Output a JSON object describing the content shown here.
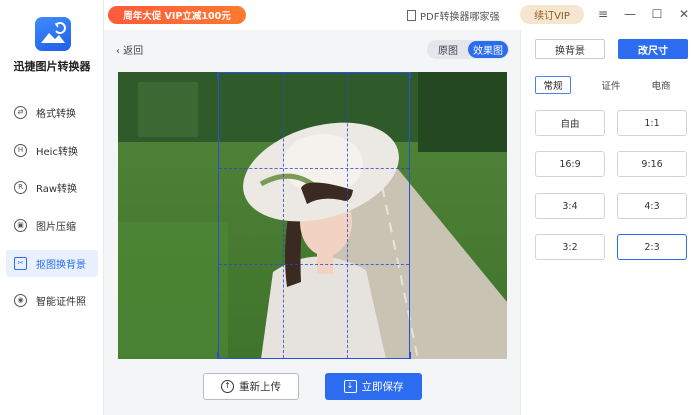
{
  "app": {
    "title": "迅捷图片转换器"
  },
  "sidebar": {
    "items": [
      {
        "label": "格式转换",
        "icon": "format-convert-icon",
        "glyph": "⇄"
      },
      {
        "label": "Heic转换",
        "icon": "heic-icon",
        "glyph": "H"
      },
      {
        "label": "Raw转换",
        "icon": "raw-icon",
        "glyph": "R"
      },
      {
        "label": "图片压缩",
        "icon": "compress-icon",
        "glyph": "▣"
      },
      {
        "label": "抠图换背景",
        "icon": "cutout-icon",
        "glyph": "✂"
      },
      {
        "label": "智能证件照",
        "icon": "id-photo-icon",
        "glyph": "◉"
      }
    ],
    "active_index": 4
  },
  "topbar": {
    "promo": "周年大促 VIP立减100元",
    "pdf_link": "PDF转换器哪家强",
    "vip_button": "续订VIP",
    "menu_glyph": "≡",
    "minimize_glyph": "—",
    "maximize_glyph": "☐",
    "close_glyph": "✕"
  },
  "main": {
    "back_label": "‹  返回",
    "view_toggle": [
      "原图",
      "效果图"
    ],
    "active_view": "效果图",
    "reupload_button": "重新上传",
    "reupload_glyph": "↑",
    "save_button": "立即保存",
    "save_glyph": "↓"
  },
  "panel": {
    "tabs": {
      "change_bg": "换背景",
      "resize": "改尺寸"
    },
    "categories": [
      "常规",
      "证件",
      "电商"
    ],
    "active_category": "常规",
    "ratios": [
      "自由",
      "1:1",
      "16:9",
      "9:16",
      "3:4",
      "4:3",
      "3:2",
      "2:3"
    ],
    "active_ratio": "2:3"
  },
  "colors": {
    "accent": "#2b6cf0",
    "promo": "#ff5a3c",
    "vip": "#f7e6cf"
  }
}
